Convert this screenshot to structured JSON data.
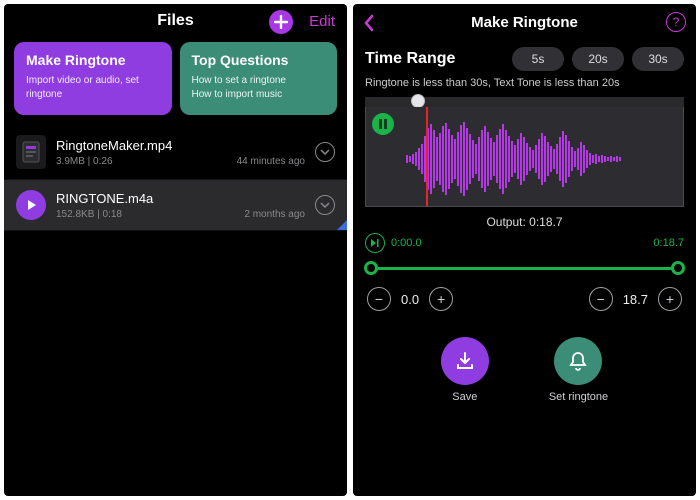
{
  "left": {
    "title": "Files",
    "edit": "Edit",
    "cards": [
      {
        "title": "Make Ringtone",
        "sub": "Import video or audio, set ringtone"
      },
      {
        "title": "Top Questions",
        "sub": "How to set a ringtone\nHow to import music"
      }
    ],
    "files": [
      {
        "name": "RingtoneMaker.mp4",
        "meta": "3.9MB | 0:26",
        "age": "44 minutes ago"
      },
      {
        "name": "RINGTONE.m4a",
        "meta": "152.8KB | 0:18",
        "age": "2 months ago"
      }
    ]
  },
  "right": {
    "title": "Make Ringtone",
    "timeRangeLabel": "Time Range",
    "segs": [
      "5s",
      "20s",
      "30s"
    ],
    "hint": "Ringtone is less than 30s, Text Tone is less than 20s",
    "output": "Output: 0:18.7",
    "tStart": "0:00.0",
    "tEnd": "0:18.7",
    "trimStart": "0.0",
    "trimEnd": "18.7",
    "saveLabel": "Save",
    "ringLabel": "Set ringtone"
  }
}
